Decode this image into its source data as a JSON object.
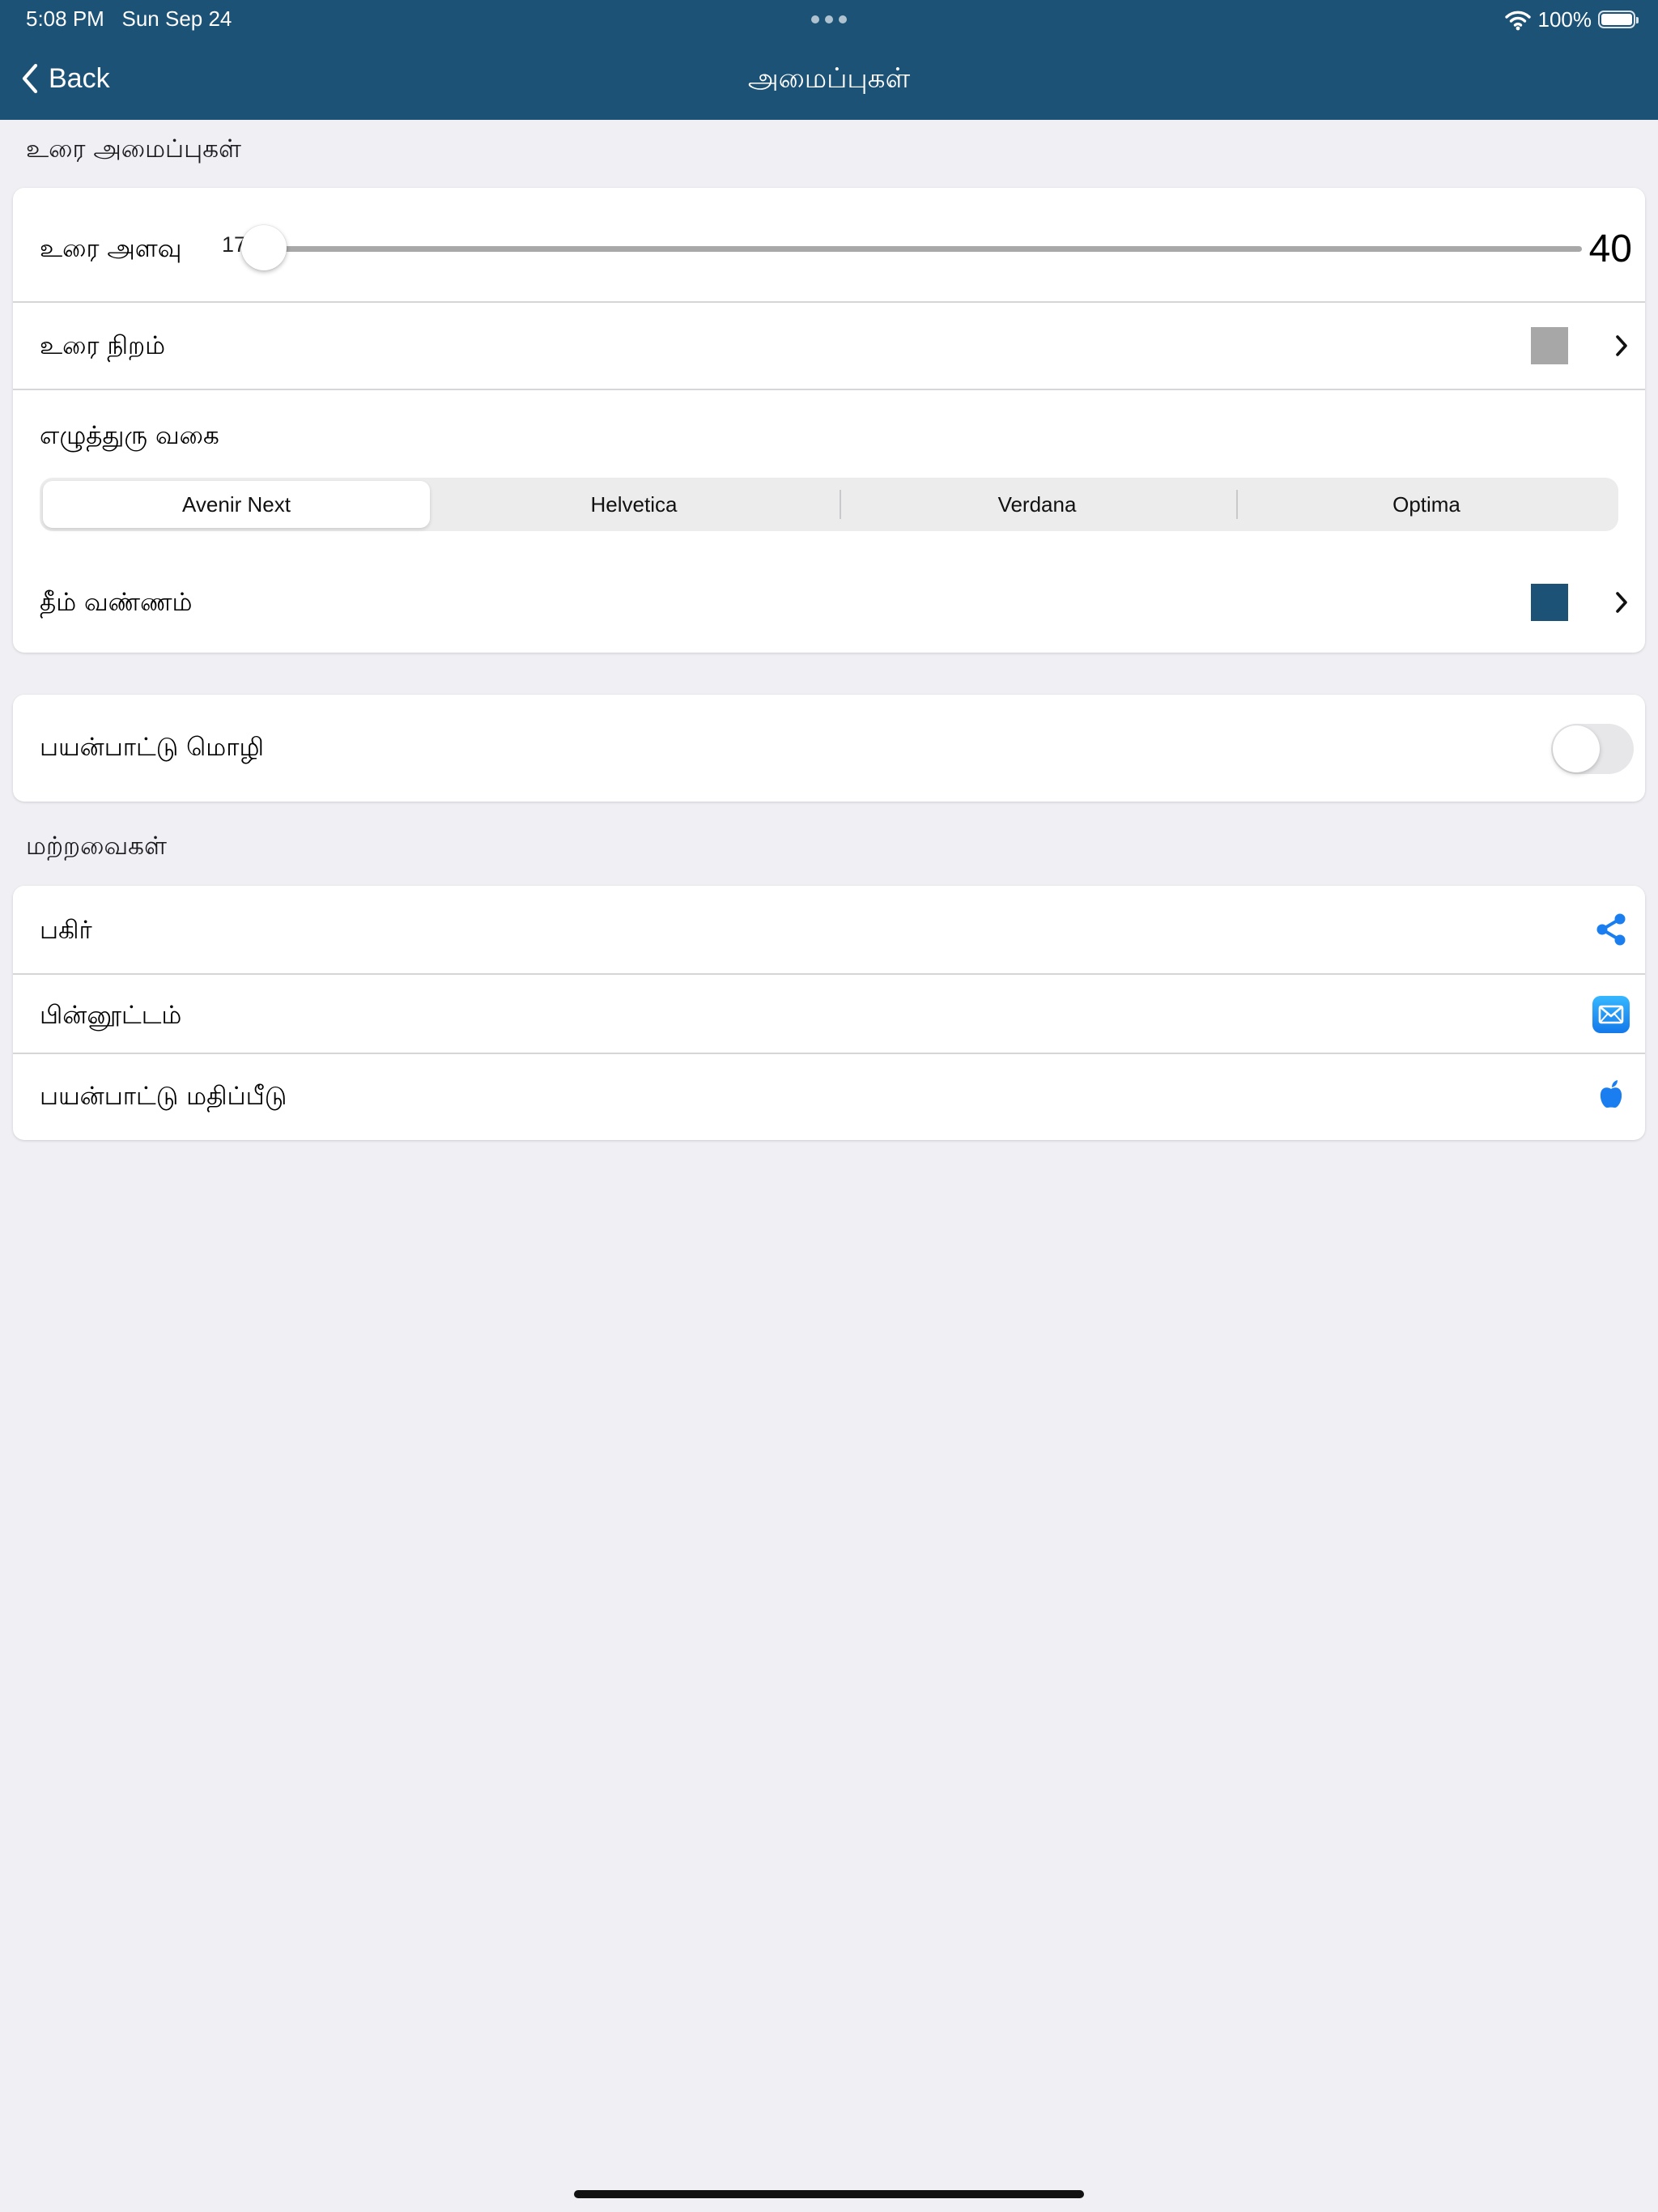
{
  "status": {
    "time": "5:08 PM",
    "date": "Sun Sep 24",
    "battery_percent": "100%",
    "battery_level": 1.0,
    "wifi_icon": "wifi-icon",
    "battery_icon": "battery-icon"
  },
  "nav": {
    "back_label": "Back",
    "title": "அமைப்புகள்"
  },
  "text_settings": {
    "section_title": "உரை அமைப்புகள்",
    "size_label": "உரை அளவு",
    "size_value": "17",
    "size_max": "40",
    "size_min_value": 17,
    "size_max_value": 40,
    "color_label": "உரை நிறம்",
    "color_swatch": "#a7a7a7",
    "font_label": "எழுத்துரு வகை",
    "fonts": [
      "Avenir Next",
      "Helvetica",
      "Verdana",
      "Optima"
    ],
    "selected_font": "Avenir Next",
    "theme_label": "தீம் வண்ணம்",
    "theme_swatch": "#1b5276"
  },
  "language": {
    "label": "பயன்பாட்டு மொழி",
    "toggle_on": false
  },
  "others": {
    "section_title": "மற்றவைகள்",
    "items": [
      {
        "label": "பகிர்",
        "icon": "share-icon"
      },
      {
        "label": "பின்னூட்டம்",
        "icon": "mail-icon"
      },
      {
        "label": "பயன்பாட்டு மதிப்பீடு",
        "icon": "apple-icon"
      }
    ]
  },
  "colors": {
    "accent": "#1b5276",
    "icon_blue": "#1a7ef0",
    "background": "#efeff4"
  }
}
